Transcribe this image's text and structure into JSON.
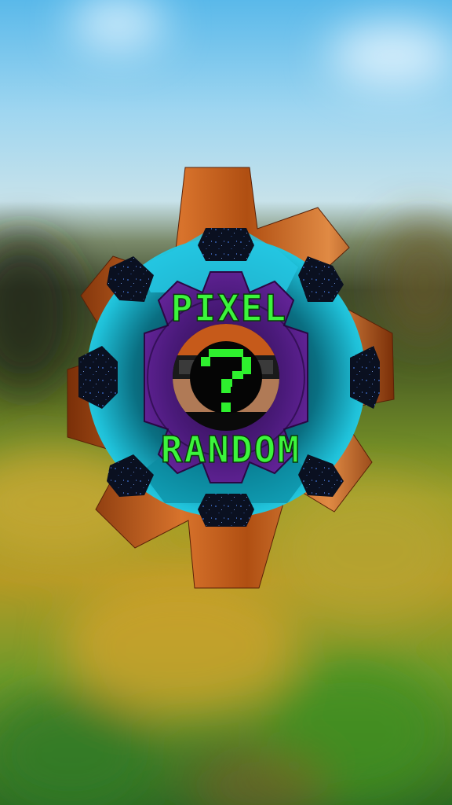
{
  "logo": {
    "top_text": "PIXEL",
    "bottom_text": "RANDOM",
    "center_glyph": "?"
  },
  "colors": {
    "sky": "#6fc4ee",
    "gear_outer": "#c5621c",
    "gear_middle": "#2ad0ea",
    "gear_inner": "#5a1b8c",
    "text": "#3cf53c"
  },
  "icons": {
    "outer_gear": "copper-gear-icon",
    "middle_gear": "cyan-gear-icon",
    "inner_gear": "purple-gear-icon",
    "center": "question-mark-icon"
  }
}
